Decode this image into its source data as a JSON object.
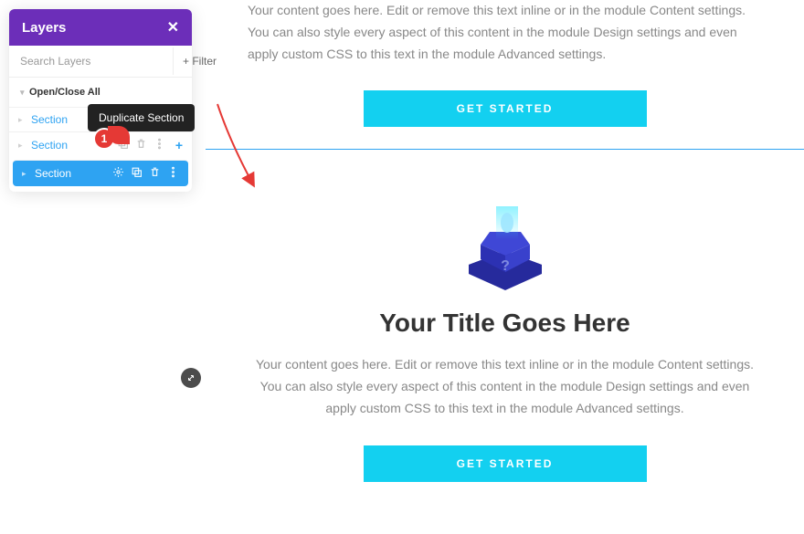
{
  "panel": {
    "title": "Layers",
    "search_placeholder": "Search Layers",
    "filter_label": "+ Filter",
    "open_close_all": "Open/Close All",
    "tooltip": "Duplicate Section",
    "callout_number": "1",
    "sections": {
      "s1": "Section",
      "s2": "Section",
      "s3": "Section"
    }
  },
  "content": {
    "body_a": "Your content goes here. Edit or remove this text inline or in the module Content settings. You can also style every aspect of this content in the module Design settings and even apply custom CSS to this text in the module Advanced settings.",
    "cta_a": "GET STARTED",
    "title_b": "Your Title Goes Here",
    "body_b": "Your content goes here. Edit or remove this text inline or in the module Content settings. You can also style every aspect of this content in the module Design settings and even apply custom CSS to this text in the module Advanced settings.",
    "cta_b": "GET STARTED"
  }
}
